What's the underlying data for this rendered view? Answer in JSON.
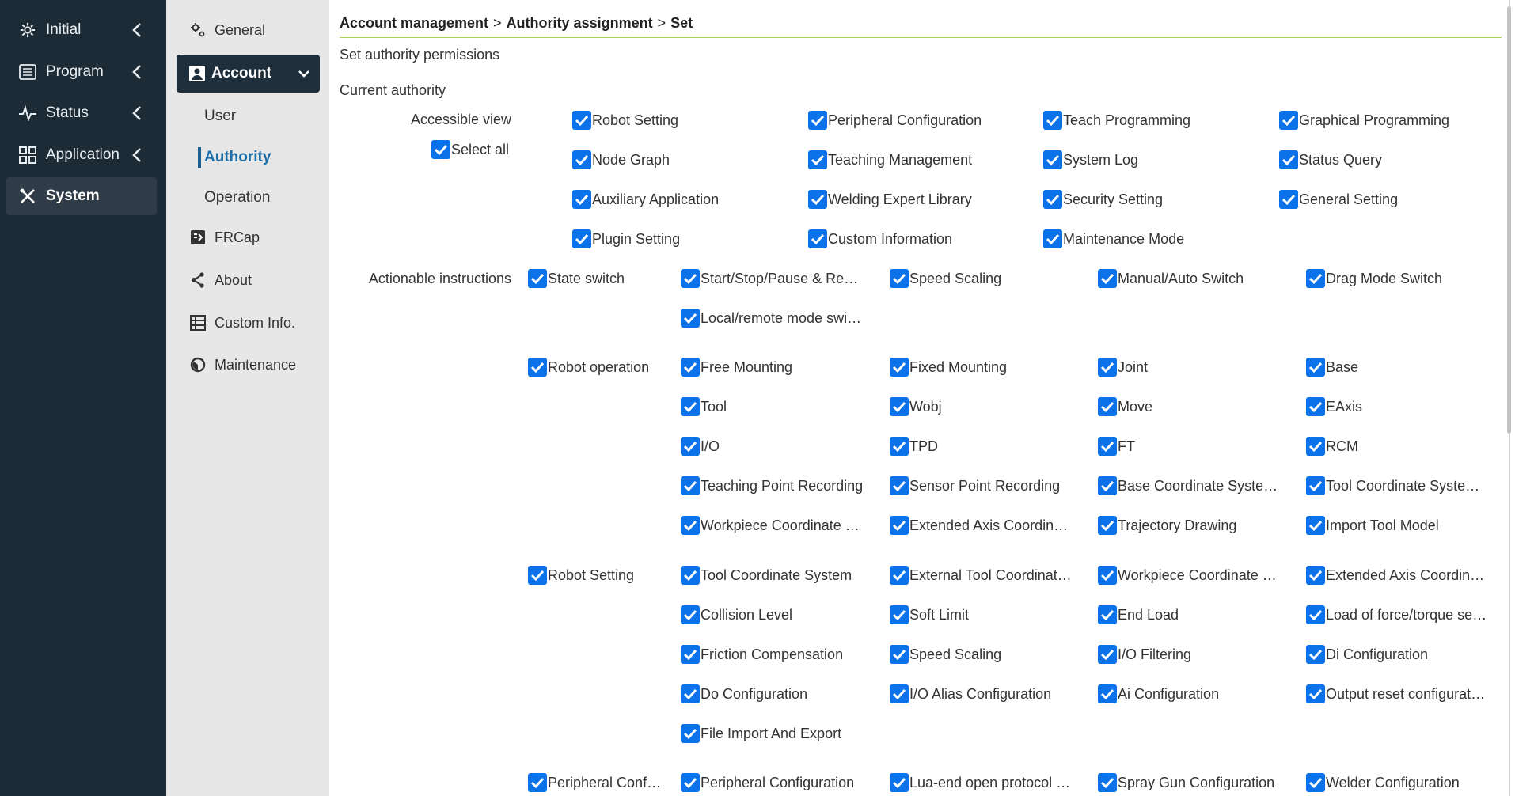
{
  "sidebar": {
    "items": [
      {
        "label": "Initial",
        "icon": "gear-icon"
      },
      {
        "label": "Program",
        "icon": "list-icon"
      },
      {
        "label": "Status",
        "icon": "pulse-icon"
      },
      {
        "label": "Application",
        "icon": "grid-icon"
      },
      {
        "label": "System",
        "icon": "tools-icon"
      }
    ]
  },
  "subnav": {
    "general": "General",
    "account": "Account",
    "user": "User",
    "authority": "Authority",
    "operation": "Operation",
    "frcap": "FRCap",
    "about": "About",
    "custom_info": "Custom Info.",
    "maintenance": "Maintenance"
  },
  "breadcrumb": {
    "part1": "Account management",
    "part2": "Authority assignment",
    "part3": "Set",
    "sep": ">"
  },
  "page": {
    "subtitle": "Set authority permissions",
    "current_authority": "Current authority",
    "accessible_view": "Accessible view",
    "select_all": "Select all",
    "actionable_instructions": "Actionable instructions"
  },
  "accessible_view_options": [
    "Robot Setting",
    "Peripheral Configuration",
    "Teach Programming",
    "Graphical Programming",
    "Node Graph",
    "Teaching Management",
    "System Log",
    "Status Query",
    "Auxiliary Application",
    "Welding Expert Library",
    "Security Setting",
    "General Setting",
    "Plugin Setting",
    "Custom Information",
    "Maintenance Mode"
  ],
  "groups": {
    "state_switch": {
      "label": "State switch",
      "items": [
        "Start/Stop/Pause & Re…",
        "Speed Scaling",
        "Manual/Auto Switch",
        "Drag Mode Switch",
        "Local/remote mode swi…"
      ]
    },
    "robot_operation": {
      "label": "Robot operation",
      "items": [
        "Free Mounting",
        "Fixed Mounting",
        "Joint",
        "Base",
        "Tool",
        "Wobj",
        "Move",
        "EAxis",
        "I/O",
        "TPD",
        "FT",
        "RCM",
        "Teaching Point Recording",
        "Sensor Point Recording",
        "Base Coordinate Syste…",
        "Tool Coordinate Syste…",
        "Workpiece Coordinate …",
        "Extended Axis Coordin…",
        "Trajectory Drawing",
        "Import Tool Model"
      ]
    },
    "robot_setting": {
      "label": "Robot Setting",
      "items": [
        "Tool Coordinate System",
        "External Tool Coordinat…",
        "Workpiece Coordinate …",
        "Extended Axis Coordin…",
        "Collision Level",
        "Soft Limit",
        "End Load",
        "Load of force/torque se…",
        "Friction Compensation",
        "Speed Scaling",
        "I/O Filtering",
        "Di Configuration",
        "Do Configuration",
        "I/O Alias Configuration",
        "Ai Configuration",
        "Output reset configurati…",
        "File Import And Export"
      ]
    },
    "peripheral": {
      "label": "Peripheral Confi…",
      "items": [
        "Peripheral Configuration",
        "Lua-end open protocol …",
        "Spray Gun Configuration",
        "Welder Configuration"
      ]
    }
  },
  "colors": {
    "sidebar_bg": "#1d2b36",
    "subnav_bg": "#e7e7e7",
    "checkbox": "#0b72ea",
    "accent_line": "#a6d45c",
    "active_link": "#1c6fa8"
  }
}
